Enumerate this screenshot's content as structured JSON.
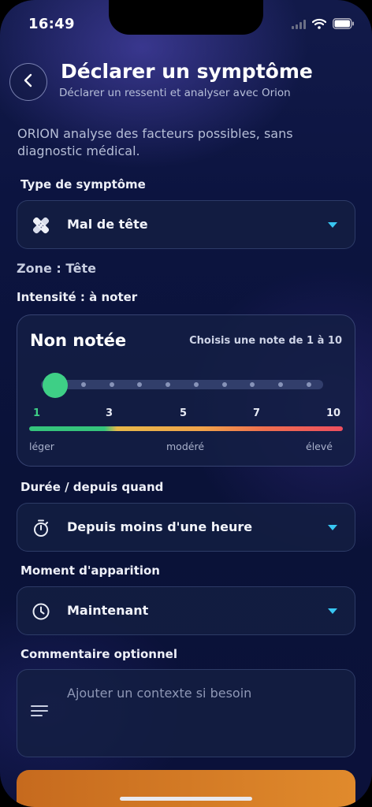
{
  "status_bar": {
    "time": "16:49"
  },
  "header": {
    "title": "Déclarer un symptôme",
    "subtitle": "Déclarer un ressenti et analyser avec Orion"
  },
  "intro": "ORION analyse des facteurs possibles, sans diagnostic médical.",
  "symptom_type": {
    "label": "Type de symptôme",
    "value": "Mal de tête",
    "icon": "bandage-icon"
  },
  "zone": "Zone : Tête",
  "intensity": {
    "label": "Intensité : à noter",
    "score_text": "Non notée",
    "hint": "Choisis une note de 1 à 10",
    "ticks": [
      "1",
      "3",
      "5",
      "7",
      "10"
    ],
    "scale": {
      "low": "léger",
      "mid": "modéré",
      "high": "élevé"
    },
    "selected": 1,
    "min": 1,
    "max": 10
  },
  "duration": {
    "label": "Durée / depuis quand",
    "value": "Depuis moins d'une heure",
    "icon": "stopwatch-icon"
  },
  "moment": {
    "label": "Moment d'apparition",
    "value": "Maintenant",
    "icon": "clock-icon"
  },
  "comment": {
    "label": "Commentaire optionnel",
    "placeholder": "Ajouter un contexte si besoin",
    "icon": "notes-icon"
  },
  "colors": {
    "accent": "#38c6f2",
    "thumb": "#3ecf86",
    "cta": "#e08a2c",
    "background": "#0c1440"
  }
}
